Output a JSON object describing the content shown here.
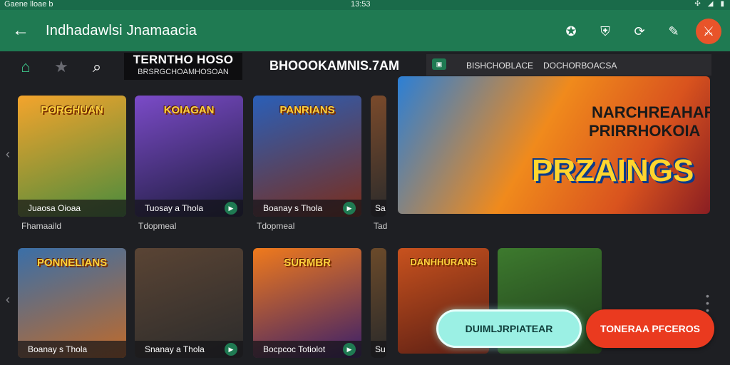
{
  "statusbar": {
    "left": "Gaene lloae b",
    "time": "13:53"
  },
  "appbar": {
    "title": "Indhadawlsi Jnamaacia"
  },
  "section": {
    "heading": "TERNTHO HOSO",
    "subheading": "BRSRGCHOAMHOSOAN",
    "link": "BHOOOKAMNIS.7AM"
  },
  "featured": {
    "line1": "BISHCHOBLACE",
    "line2": "DOCHORBOACSA"
  },
  "hero": {
    "line1": "NARCHREAHAR",
    "line2": "PRIRRHOKOIA",
    "big": "PRZAINGS"
  },
  "row1": [
    {
      "art_title": "PORGHUAN",
      "caption": "Juaosa Oioaa",
      "label": "Fhamaaild",
      "colors": [
        "#f4a42c",
        "#4a8b3d"
      ]
    },
    {
      "art_title": "KOIAGAN",
      "caption": "Tuosay a Thola",
      "label": "Tdopmeal",
      "colors": [
        "#7b4bc8",
        "#1b1b3a"
      ]
    },
    {
      "art_title": "PANRIANS",
      "caption": "Boanay s Thola",
      "label": "Tdopmeal",
      "colors": [
        "#2a5fb8",
        "#7b2d1a"
      ]
    },
    {
      "art_title": "",
      "caption": "Sa",
      "label": "Tad",
      "colors": [
        "#7a4a2b",
        "#2b2b2b"
      ]
    }
  ],
  "row2": [
    {
      "art_title": "PONNELIANS",
      "caption": "Boanay s Thola",
      "label": "",
      "colors": [
        "#3a6fa8",
        "#c06a2a"
      ]
    },
    {
      "art_title": "",
      "caption": "Snanay a Thola",
      "label": "",
      "colors": [
        "#5a4434",
        "#2b2b2b"
      ]
    },
    {
      "art_title": "SURMBR",
      "caption": "Bocpcoc Totiolot",
      "label": "",
      "colors": [
        "#f07a1c",
        "#3a1f6a"
      ]
    },
    {
      "art_title": "",
      "caption": "Su",
      "label": "",
      "colors": [
        "#6b4a2a",
        "#2a2a2a"
      ]
    },
    {
      "art_title": "DANHHURANS",
      "caption": "",
      "label": "",
      "colors": [
        "#c8521e",
        "#5a1e14"
      ]
    },
    {
      "art_title": "",
      "caption": "",
      "label": "",
      "colors": [
        "#3d7a2e",
        "#1e3a1a"
      ]
    }
  ],
  "buttons": {
    "primary": "DUIMLJRPIATEAR",
    "secondary": "TONERAA PFCEROS"
  },
  "theme": {
    "accent": "#1f7a52",
    "profile": "#e8542a",
    "cta": "#ea3a1f",
    "cta_alt": "#9bf0e4"
  }
}
